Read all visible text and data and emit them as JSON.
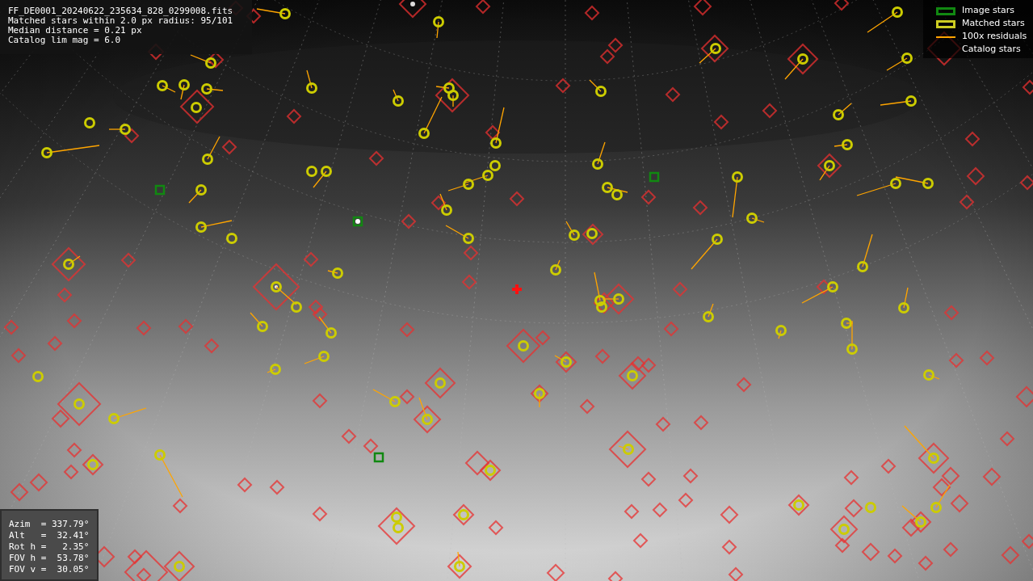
{
  "file_info": {
    "lines": [
      "FF_DE0001_20240622_235634_828_0299008.fits",
      "Matched stars within 2.0 px radius: 95/101",
      "Median distance = 0.21 px",
      "Catalog lim mag = 6.0"
    ]
  },
  "legend": [
    {
      "label": "Image stars"
    },
    {
      "kind": "matched",
      "label": "Matched stars"
    },
    {
      "kind": "residual",
      "label": "100x residuals"
    },
    {
      "kind": "catalog",
      "label": "Catalog stars"
    }
  ],
  "pointing": {
    "lines": [
      "Azim  = 337.79°",
      "Alt   =  32.41°",
      "Rot h =   2.35°",
      "FOV h =  53.78°",
      "FOV v =  30.05°"
    ]
  }
}
